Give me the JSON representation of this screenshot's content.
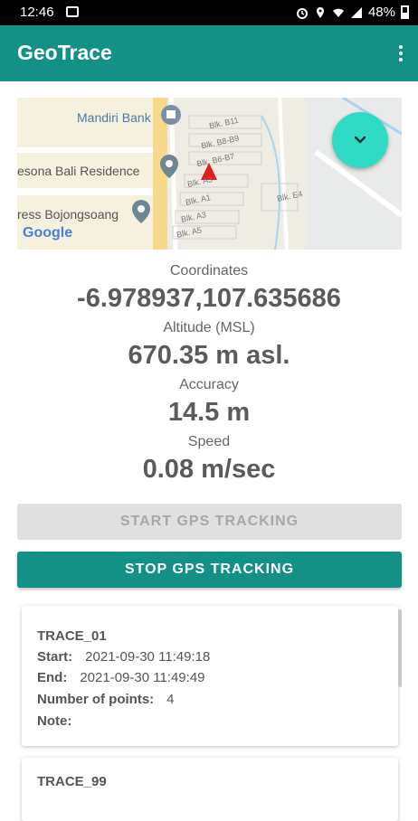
{
  "status_bar": {
    "time": "12:46",
    "battery": "48%"
  },
  "app": {
    "title": "GeoTrace"
  },
  "map": {
    "labels": {
      "bank": "Mandiri Bank",
      "residence": "esona Bali Residence",
      "bojongsoang": "ress Bojongsoang",
      "b11": "Blk. B11",
      "b9": "Blk. B8-B9",
      "b7": "Blk. B6-B7",
      "a3a": "Blk. A3",
      "a1": "Blk. A1",
      "a3": "Blk. A3",
      "a5": "Blk. A5",
      "e4": "Blk. E4"
    },
    "google_logo": "Google"
  },
  "readouts": {
    "coordinates_label": "Coordinates",
    "coordinates_value": "-6.978937,107.635686",
    "altitude_label": "Altitude (MSL)",
    "altitude_value": "670.35 m asl.",
    "accuracy_label": "Accuracy",
    "accuracy_value": "14.5 m",
    "speed_label": "Speed",
    "speed_value": "0.08 m/sec"
  },
  "buttons": {
    "start": "START GPS TRACKING",
    "stop": "STOP GPS TRACKING"
  },
  "traces": [
    {
      "name": "TRACE_01",
      "start_label": "Start:",
      "start": "2021-09-30 11:49:18",
      "end_label": "End:",
      "end": "2021-09-30 11:49:49",
      "points_label": "Number of points:",
      "points": "4",
      "note_label": "Note:"
    },
    {
      "name": "TRACE_99"
    }
  ]
}
